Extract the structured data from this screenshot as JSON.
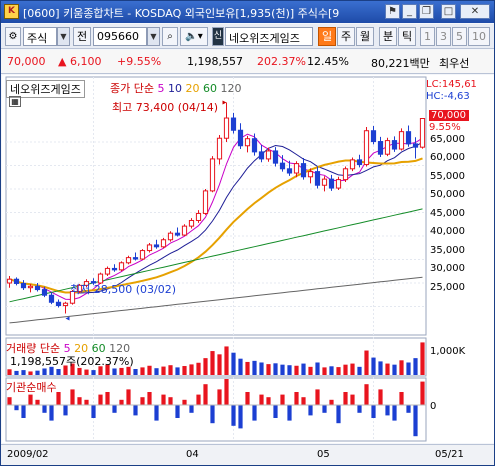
{
  "window": {
    "title": "[0600] 키움종합차트 - KOSDAQ 외국인보유[1,935(천)] 주식수[9",
    "icons": [
      "pin-icon",
      "minimize-icon",
      "restore-icon",
      "maximize-icon",
      "close-icon"
    ]
  },
  "toolbar": {
    "market": "주식",
    "prev_label": "전",
    "code": "095660",
    "stock_name": "네오위즈게임즈",
    "period_buttons": [
      "일",
      "주",
      "월",
      "분",
      "틱",
      "1",
      "3",
      "5",
      "10"
    ],
    "active_period": "일"
  },
  "quote": {
    "price": "70,000",
    "change": "▲ 6,100",
    "change_pct": "+9.55%",
    "volume": "1,198,557",
    "volume_ratio": "202.37%",
    "turnover": "12.45%",
    "amount": "80,221백만",
    "extra": "최우선"
  },
  "price_panel": {
    "stock_label": "네오위즈게임즈",
    "ma_legend": {
      "title": "종가 단순",
      "periods": [
        "5",
        "10",
        "20",
        "60",
        "120"
      ]
    },
    "lc": "LC:145,61",
    "hc": "HC:-4,63",
    "current_price": "70,000",
    "current_pct": "9.55%",
    "high_note": "최고 73,400 (04/14)",
    "low_note": "최저 28,500 (03/02)",
    "y_ticks": [
      "65,000",
      "60,000",
      "55,000",
      "50,000",
      "45,000",
      "40,000",
      "35,000",
      "30,000",
      "25,000"
    ]
  },
  "volume_panel": {
    "legend_title": "거래량 단순",
    "periods": [
      "5",
      "20",
      "60",
      "120"
    ],
    "value": "1,198,557주(202.37%)",
    "y_tick": "1,000K"
  },
  "inst_panel": {
    "title": "기관순매수",
    "y_tick": "0"
  },
  "x_axis": {
    "labels": [
      "2009/02",
      "04",
      "05",
      "05/21"
    ]
  },
  "colors": {
    "up": "#e8141e",
    "down": "#1c3fd2",
    "ma5": "#c800c8",
    "ma10": "#1e1e96",
    "ma20": "#e6a100",
    "ma60": "#148c28",
    "ma120": "#646464"
  },
  "chart_data": {
    "type": "candlestick",
    "price_range": [
      25000,
      75000
    ],
    "ohlc": [
      [
        35000,
        36500,
        34000,
        35800
      ],
      [
        35800,
        36200,
        34500,
        34900
      ],
      [
        34900,
        35600,
        33500,
        34000
      ],
      [
        34000,
        34800,
        33000,
        34300
      ],
      [
        34300,
        35000,
        33200,
        33600
      ],
      [
        33600,
        34200,
        32000,
        32400
      ],
      [
        32400,
        33000,
        30500,
        30900
      ],
      [
        30900,
        31500,
        29800,
        30200
      ],
      [
        30200,
        31000,
        28500,
        30700
      ],
      [
        30700,
        33500,
        30400,
        33200
      ],
      [
        33200,
        34800,
        32800,
        34500
      ],
      [
        34500,
        35800,
        34100,
        35300
      ],
      [
        35300,
        36000,
        34600,
        35000
      ],
      [
        35000,
        37200,
        34800,
        36900
      ],
      [
        36900,
        38500,
        36500,
        38100
      ],
      [
        38100,
        39000,
        37400,
        37800
      ],
      [
        37800,
        39600,
        37500,
        39300
      ],
      [
        39300,
        40800,
        39000,
        40400
      ],
      [
        40400,
        41500,
        39800,
        40100
      ],
      [
        40100,
        42200,
        39900,
        41900
      ],
      [
        41900,
        43500,
        41500,
        43100
      ],
      [
        43100,
        44200,
        42300,
        42700
      ],
      [
        42700,
        44600,
        42400,
        44200
      ],
      [
        44200,
        46000,
        43800,
        45600
      ],
      [
        45600,
        46800,
        44900,
        45200
      ],
      [
        45200,
        47500,
        45000,
        47100
      ],
      [
        47100,
        48800,
        46600,
        48300
      ],
      [
        48300,
        50500,
        47800,
        49800
      ],
      [
        49800,
        55000,
        49500,
        54600
      ],
      [
        54600,
        62000,
        54300,
        61400
      ],
      [
        61400,
        66500,
        60200,
        65800
      ],
      [
        65800,
        73400,
        65000,
        70100
      ],
      [
        70100,
        71200,
        66800,
        67500
      ],
      [
        67500,
        69000,
        63500,
        64200
      ],
      [
        64200,
        66300,
        62800,
        65700
      ],
      [
        65700,
        66800,
        62100,
        62900
      ],
      [
        62900,
        64400,
        60700,
        61400
      ],
      [
        61400,
        63800,
        60800,
        63100
      ],
      [
        63100,
        63900,
        59800,
        60500
      ],
      [
        60500,
        62200,
        58700,
        59300
      ],
      [
        59300,
        61000,
        57800,
        58400
      ],
      [
        58400,
        60900,
        57500,
        60400
      ],
      [
        60400,
        61600,
        57000,
        57600
      ],
      [
        57600,
        59400,
        56200,
        58700
      ],
      [
        58700,
        59800,
        55100,
        55800
      ],
      [
        55800,
        57700,
        54500,
        57100
      ],
      [
        57100,
        58000,
        54600,
        55200
      ],
      [
        55200,
        57600,
        54800,
        57000
      ],
      [
        57000,
        59800,
        56500,
        59300
      ],
      [
        59300,
        61700,
        58800,
        61200
      ],
      [
        61200,
        62300,
        59600,
        60200
      ],
      [
        60200,
        68200,
        59800,
        67400
      ],
      [
        67400,
        68400,
        64500,
        65100
      ],
      [
        65100,
        66100,
        61800,
        62400
      ],
      [
        62400,
        65900,
        62000,
        65300
      ],
      [
        65300,
        66200,
        62900,
        63500
      ],
      [
        63500,
        67900,
        63200,
        67200
      ],
      [
        67200,
        68500,
        64000,
        64600
      ],
      [
        64600,
        66000,
        61500,
        63900
      ],
      [
        63900,
        70000,
        63600,
        70000
      ]
    ],
    "volume_k": [
      210,
      150,
      180,
      130,
      160,
      240,
      300,
      220,
      350,
      420,
      260,
      200,
      180,
      320,
      380,
      240,
      260,
      300,
      220,
      280,
      340,
      250,
      310,
      360,
      280,
      330,
      390,
      450,
      620,
      880,
      760,
      1050,
      820,
      600,
      480,
      520,
      460,
      400,
      430,
      380,
      360,
      340,
      420,
      300,
      460,
      280,
      320,
      290,
      380,
      420,
      300,
      900,
      640,
      500,
      420,
      380,
      540,
      460,
      620,
      1198
    ],
    "inst_net": [
      3,
      -2,
      -5,
      4,
      2,
      -3,
      -6,
      5,
      -4,
      6,
      3,
      2,
      -5,
      4,
      5,
      -3,
      2,
      6,
      -4,
      3,
      5,
      -6,
      4,
      3,
      -5,
      2,
      -3,
      4,
      8,
      -7,
      6,
      10,
      -8,
      -9,
      5,
      -6,
      4,
      3,
      -5,
      4,
      -6,
      5,
      3,
      -4,
      6,
      -3,
      2,
      -7,
      5,
      4,
      -3,
      8,
      -5,
      6,
      -4,
      -6,
      5,
      -3,
      -12,
      9
    ]
  }
}
